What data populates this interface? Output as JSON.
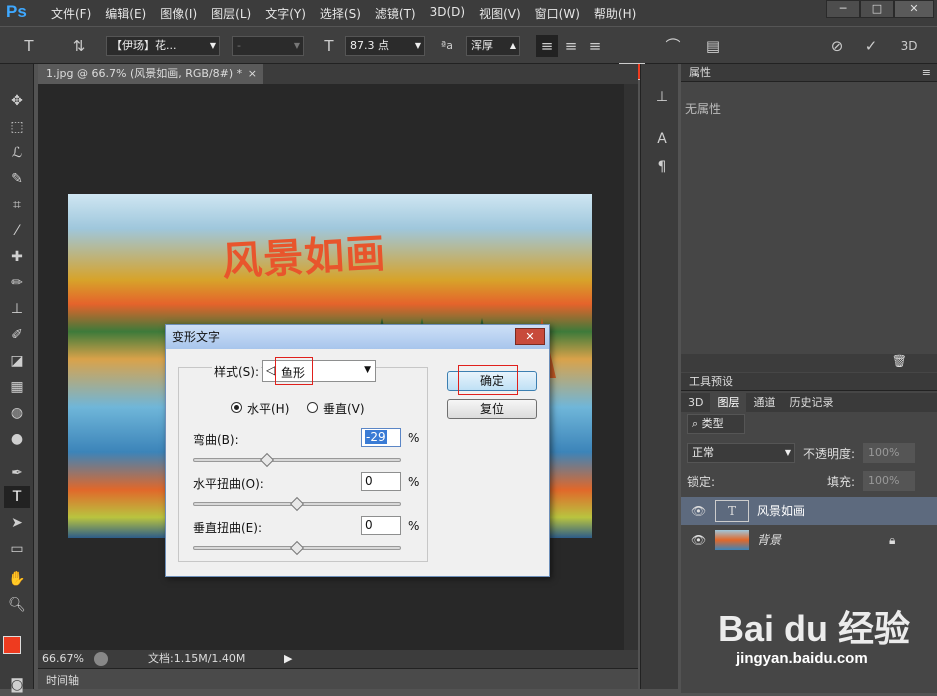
{
  "app": {
    "logo": "Ps"
  },
  "menu": [
    "文件(F)",
    "编辑(E)",
    "图像(I)",
    "图层(L)",
    "文字(Y)",
    "选择(S)",
    "滤镜(T)",
    "3D(D)",
    "视图(V)",
    "窗口(W)",
    "帮助(H)"
  ],
  "window_buttons": [
    "─",
    "□",
    "✕"
  ],
  "options": {
    "font_family": "【伊玚】花...",
    "font_style": "-",
    "font_size": "87.3 点",
    "antialias": "浑厚",
    "aa_label": "ªa",
    "color": "#ee3b1f"
  },
  "document": {
    "tab_title": "1.jpg @ 66.7% (风景如画, RGB/8#) *",
    "art_text": "风景如画",
    "zoom": "66.67%",
    "doc_info": "文档:1.15M/1.40M"
  },
  "timeline": {
    "label": "时间轴"
  },
  "dialog": {
    "title": "变形文字",
    "close": "✕",
    "style_label": "样式(S):",
    "style_value": "鱼形",
    "horizontal": "水平(H)",
    "vertical": "垂直(V)",
    "bend_label": "弯曲(B):",
    "bend_value": "-29",
    "h_distort_label": "水平扭曲(O):",
    "h_distort_value": "0",
    "v_distort_label": "垂直扭曲(E):",
    "v_distort_value": "0",
    "percent": "%",
    "ok": "确定",
    "reset": "复位",
    "bend_level": 0.355,
    "h_level": 0.5,
    "v_level": 0.5
  },
  "properties": {
    "title": "属性",
    "empty": "无属性"
  },
  "tool_presets": {
    "title": "工具预设"
  },
  "layers_panel": {
    "tabs": [
      "3D",
      "图层",
      "通道",
      "历史记录"
    ],
    "filter": "类型",
    "blend_mode": "正常",
    "opacity_label": "不透明度:",
    "opacity": "100%",
    "lock_label": "锁定:",
    "fill_label": "填充:",
    "fill": "100%",
    "layers": [
      {
        "name": "风景如画",
        "type": "T"
      },
      {
        "name": "背景"
      }
    ]
  },
  "watermark": {
    "main": "Bai du 经验",
    "url": "jingyan.baidu.com"
  }
}
